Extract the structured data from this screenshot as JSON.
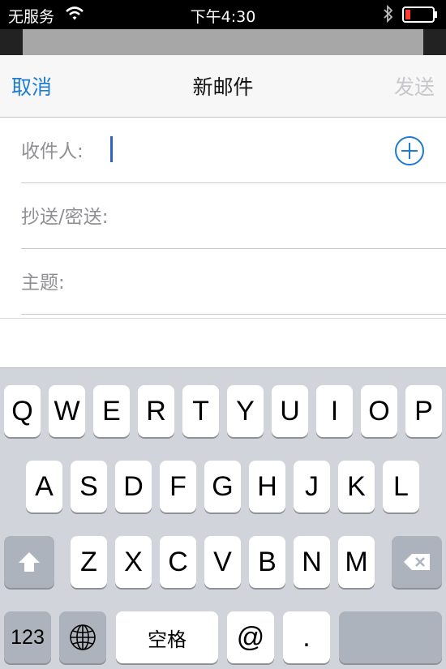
{
  "status_bar": {
    "carrier": "无服务",
    "time": "下午4:30"
  },
  "colors": {
    "accent": "#1d7bd1",
    "disabled": "#c7c7cc",
    "label": "#8e8e93",
    "caret": "#2f61d2",
    "battery_low": "#ff3b30"
  },
  "nav": {
    "cancel_label": "取消",
    "title": "新邮件",
    "send_label": "发送"
  },
  "fields": {
    "to_label": "收件人:",
    "cc_bcc_label": "抄送/密送:",
    "subject_label": "主题:"
  },
  "keyboard": {
    "row1": [
      "Q",
      "W",
      "E",
      "R",
      "T",
      "Y",
      "U",
      "I",
      "O",
      "P"
    ],
    "row2": [
      "A",
      "S",
      "D",
      "F",
      "G",
      "H",
      "J",
      "K",
      "L"
    ],
    "row3": [
      "Z",
      "X",
      "C",
      "V",
      "B",
      "N",
      "M"
    ],
    "numbers_label": "123",
    "space_label": "空格",
    "at_label": "@",
    "dot_label": ".",
    "shift_icon": "shift-arrow-icon",
    "delete_icon": "backspace-icon",
    "globe_icon": "globe-icon"
  }
}
